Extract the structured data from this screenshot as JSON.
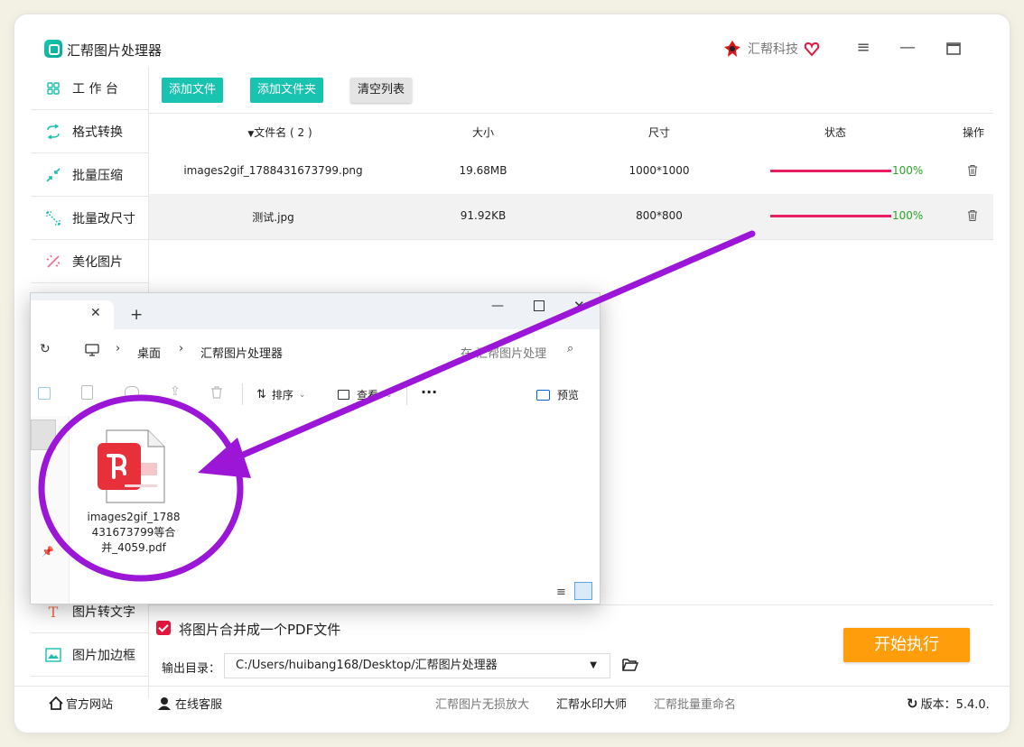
{
  "app": {
    "title": "汇帮图片处理器",
    "brand": "汇帮科技",
    "window_controls": [
      "menu-icon",
      "minimize-icon",
      "maximize-icon"
    ]
  },
  "sidebar": {
    "items": [
      {
        "label": "工 作 台",
        "icon": "grid-icon"
      },
      {
        "label": "格式转换",
        "icon": "convert-icon"
      },
      {
        "label": "批量压缩",
        "icon": "compress-icon"
      },
      {
        "label": "批量改尺寸",
        "icon": "resize-icon"
      },
      {
        "label": "美化图片",
        "icon": "beautify-icon"
      },
      {
        "label": "图片转文字",
        "icon": "text-icon"
      },
      {
        "label": "图片加边框",
        "icon": "frame-icon"
      }
    ]
  },
  "toolbar": {
    "add_file": "添加文件",
    "add_folder": "添加文件夹",
    "clear_list": "清空列表"
  },
  "table": {
    "headers": {
      "name": "文件名 ( 2 )",
      "size": "大小",
      "dims": "尺寸",
      "status": "状态",
      "action": "操作"
    },
    "rows": [
      {
        "name": "images2gif_1788431673799.png",
        "size": "19.68MB",
        "dims": "1000*1000",
        "progress": 1.0,
        "percent": "100%"
      },
      {
        "name": "测试.jpg",
        "size": "91.92KB",
        "dims": "800*800",
        "progress": 1.0,
        "percent": "100%"
      }
    ]
  },
  "options": {
    "merge_checkbox_label": "将图片合并成一个PDF文件",
    "merge_checked": true,
    "output_label": "输出目录：",
    "output_path": "C:/Users/huibang168/Desktop/汇帮图片处理器"
  },
  "start_button": "开始执行",
  "footer": {
    "website": "官方网站",
    "support": "在线客服",
    "link1": "汇帮图片无损放大",
    "link2": "汇帮水印大师",
    "link3": "汇帮批量重命名",
    "version": "版本：5.4.0."
  },
  "explorer": {
    "breadcrumb": [
      "桌面",
      "汇帮图片处理器"
    ],
    "search_placeholder": "在 汇帮图片处理",
    "sort_label": "排序",
    "view_label": "查看",
    "more_label": "···",
    "preview_label": "预览",
    "file_name": "images2gif_1788431673799等合并_4059.pdf"
  },
  "colors": {
    "accent": "#18c4b0",
    "progress": "#e91e63",
    "start": "#ff9d0a",
    "annotation": "#9b16d6"
  }
}
